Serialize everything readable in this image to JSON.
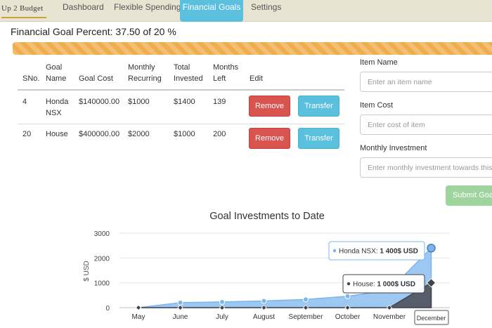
{
  "nav": {
    "brand": "Up 2 Budget",
    "tabs": [
      {
        "label": "Dashboard"
      },
      {
        "label": "Flexible Spendings"
      },
      {
        "label": "Financial Goals"
      },
      {
        "label": "Settings"
      }
    ],
    "active_tab": "Financial Goals"
  },
  "colors": {
    "nav_bg": "#e7e4d2",
    "active_tab": "#5bc0de",
    "progress": "#f0ad4e",
    "remove": "#d9534f",
    "transfer": "#5bc0de",
    "submit": "#9fd49f",
    "honda_series": "#7cb5ec",
    "house_series": "#434348"
  },
  "goal_percent": {
    "text": "Financial Goal Percent: 37.50 of 20 %",
    "fill_percent": 100
  },
  "table": {
    "headers": {
      "sno": "SNo.",
      "goal_name": "Goal Name",
      "goal_cost": "Goal Cost",
      "monthly_recurring": "Monthly Recurring",
      "total_invested": "Total Invested",
      "months_left": "Months Left",
      "edit": "Edit"
    },
    "rows": [
      {
        "sno": "4",
        "goal_name": "Honda NSX",
        "goal_cost": "$140000.00",
        "monthly_recurring": "$1000",
        "total_invested": "$1400",
        "months_left": "139",
        "remove_label": "Remove",
        "transfer_label": "Transfer"
      },
      {
        "sno": "20",
        "goal_name": "House",
        "goal_cost": "$400000.00",
        "monthly_recurring": "$2000",
        "total_invested": "$1000",
        "months_left": "200",
        "remove_label": "Remove",
        "transfer_label": "Transfer"
      }
    ]
  },
  "form": {
    "item_name_label": "Item Name",
    "item_name_placeholder": "Enter an item name",
    "item_cost_label": "Item Cost",
    "item_cost_placeholder": "Enter cost of item",
    "monthly_label": "Monthly Investment",
    "monthly_placeholder": "Enter monthly investment towards this goal",
    "submit_label": "Submit Goal"
  },
  "chart_data": {
    "type": "area",
    "title": "Goal Investments to Date",
    "ylabel": "$ USD",
    "xlabel": "",
    "categories": [
      "May",
      "June",
      "July",
      "August",
      "September",
      "October",
      "November",
      "December"
    ],
    "ylim": [
      0,
      3000
    ],
    "yticks": [
      0,
      1000,
      2000,
      3000
    ],
    "grid": true,
    "series": [
      {
        "name": "Honda NSX",
        "values": [
          0,
          200,
          230,
          270,
          330,
          460,
          700,
          2400
        ],
        "color": "#7cb5ec"
      },
      {
        "name": "House",
        "values": [
          0,
          0,
          0,
          0,
          0,
          0,
          0,
          1000
        ],
        "color": "#434348"
      }
    ],
    "tooltips": [
      {
        "series": "Honda NSX",
        "text": "Honda NSX:",
        "value": "1 400$ USD"
      },
      {
        "series": "House",
        "text": "House:",
        "value": "1 000$ USD"
      }
    ],
    "highlighted_category": "December"
  }
}
